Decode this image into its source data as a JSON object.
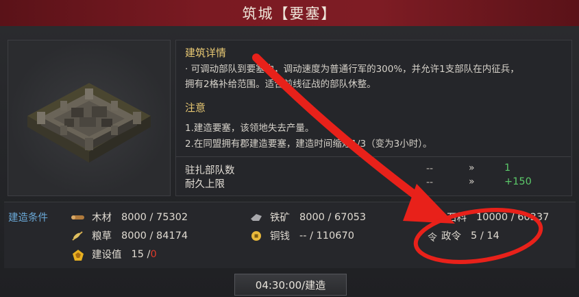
{
  "title": "筑城【要塞】",
  "details": {
    "heading": "建筑详情",
    "line1": "· 可调动部队到要塞中，调动速度为普通行军的300%，并允许1支部队在内征兵，",
    "line2": "拥有2格补给范围。适合前线征战的部队休整。"
  },
  "notes": {
    "heading": "注意",
    "line1": "1.建造要塞，该领地失去产量。",
    "line2": "2.在同盟拥有郡建造要塞，建造时间缩短1/3（变为3小时）。"
  },
  "stats": [
    {
      "label": "驻扎部队数",
      "current": "--",
      "arrow": "»",
      "value": "1"
    },
    {
      "label": "耐久上限",
      "current": "--",
      "arrow": "»",
      "value": "+150"
    }
  ],
  "conditions": {
    "title": "建造条件",
    "wood": {
      "icon": "wood-icon",
      "name": "木材",
      "value": "8000 / 75302"
    },
    "iron": {
      "icon": "iron-icon",
      "name": "铁矿",
      "value": "8000 / 67053"
    },
    "stone": {
      "icon": "stone-icon",
      "name": "石料",
      "value": "10000 / 60337"
    },
    "grain": {
      "icon": "grain-icon",
      "name": "粮草",
      "value": "8000 / 84174"
    },
    "copper": {
      "icon": "coin-icon",
      "name": "铜钱",
      "value": "-- / 110670"
    },
    "order": {
      "icon": "order-icon",
      "name": "政令",
      "value": "5 / 14",
      "glyph": "令"
    },
    "construction": {
      "icon": "construction-icon",
      "name": "建设值",
      "have": "15 / ",
      "need": "0"
    }
  },
  "build_button": "04:30:00/建造",
  "colors": {
    "accent_gold": "#e8c873",
    "positive_green": "#5cc96a",
    "annotation_red": "#e8211a",
    "label_blue": "#6aa9d8"
  }
}
